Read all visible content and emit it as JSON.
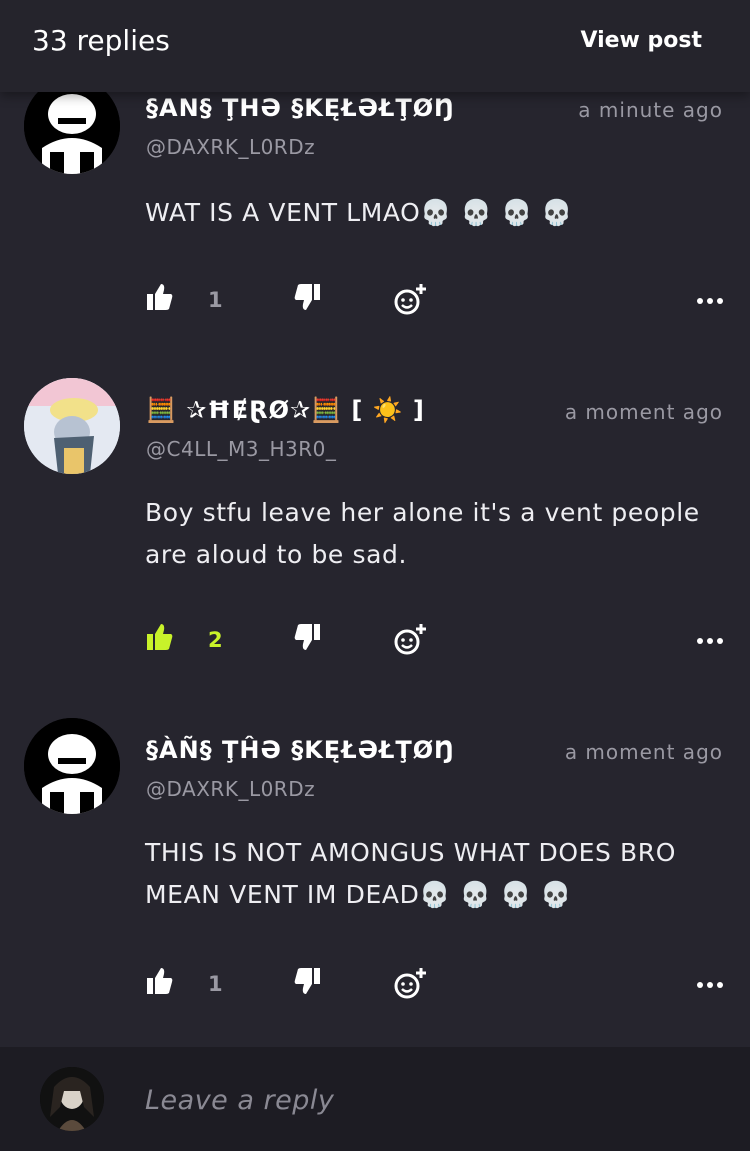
{
  "header": {
    "replies": "33 replies",
    "view_post": "View post"
  },
  "comments": [
    {
      "name": "§AN§ ŢHƏ §KĘŁƏŁŢØŊ",
      "handle": "@DAXRK_L0RDz",
      "time": "a minute ago",
      "text": "WAT IS A VENT LMAO💀 💀 💀 💀",
      "likes": "1",
      "liked": false
    },
    {
      "name": "🧮 ✰ĦɆⱤØ✰🧮 [ ☀️ ]",
      "handle": "@C4LL_M3_H3R0_",
      "time": "a moment ago",
      "text": "Boy stfu leave her alone it's a vent people are aloud to be sad.",
      "likes": "2",
      "liked": true
    },
    {
      "name": "§ÀÑ§ ŢĤƏ §KĘŁƏŁŢØŊ",
      "handle": "@DAXRK_L0RDz",
      "time": "a moment ago",
      "text": "THIS IS NOT AMONGUS WHAT DOES BRO MEAN VENT IM DEAD💀 💀 💀 💀",
      "likes": "1",
      "liked": false
    }
  ],
  "footer": {
    "placeholder": "Leave a reply"
  },
  "colors": {
    "accent": "#c8f22a",
    "background": "#26252e",
    "footer": "#1d1c23"
  },
  "icons": [
    "thumbs-up-icon",
    "thumbs-down-icon",
    "add-reaction-icon",
    "more-icon"
  ]
}
